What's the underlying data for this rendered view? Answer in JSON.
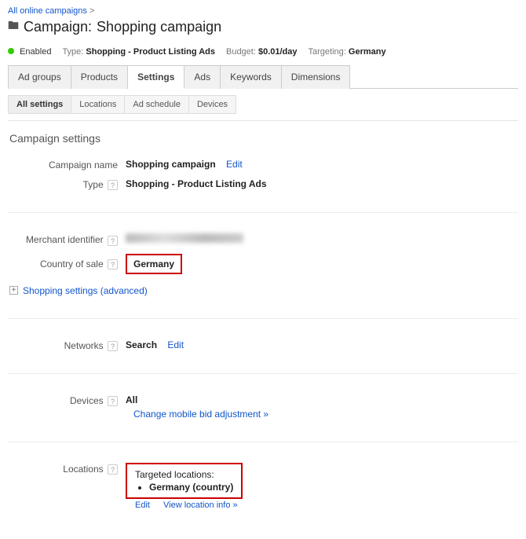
{
  "breadcrumb": {
    "parent": "All online campaigns"
  },
  "header": {
    "prefix": "Campaign:",
    "name": "Shopping campaign"
  },
  "status": {
    "state": "Enabled",
    "type_label": "Type:",
    "type_value": "Shopping - Product Listing Ads",
    "budget_label": "Budget:",
    "budget_value": "$0.01/day",
    "targeting_label": "Targeting:",
    "targeting_value": "Germany"
  },
  "tabs": {
    "items": [
      "Ad groups",
      "Products",
      "Settings",
      "Ads",
      "Keywords",
      "Dimensions"
    ],
    "active": "Settings"
  },
  "subtabs": {
    "items": [
      "All settings",
      "Locations",
      "Ad schedule",
      "Devices"
    ],
    "active": "All settings"
  },
  "section_title": "Campaign settings",
  "settings": {
    "campaign_name": {
      "label": "Campaign name",
      "value": "Shopping campaign",
      "edit": "Edit"
    },
    "type": {
      "label": "Type",
      "value": "Shopping - Product Listing Ads"
    },
    "merchant": {
      "label": "Merchant identifier"
    },
    "country": {
      "label": "Country of sale",
      "value": "Germany"
    },
    "advanced": {
      "label": "Shopping settings (advanced)"
    },
    "networks": {
      "label": "Networks",
      "value": "Search",
      "edit": "Edit"
    },
    "devices": {
      "label": "Devices",
      "value": "All",
      "link": "Change mobile bid adjustment »"
    },
    "locations": {
      "label": "Locations",
      "heading": "Targeted locations:",
      "item": "Germany (country)",
      "edit": "Edit",
      "view": "View location info »"
    }
  }
}
